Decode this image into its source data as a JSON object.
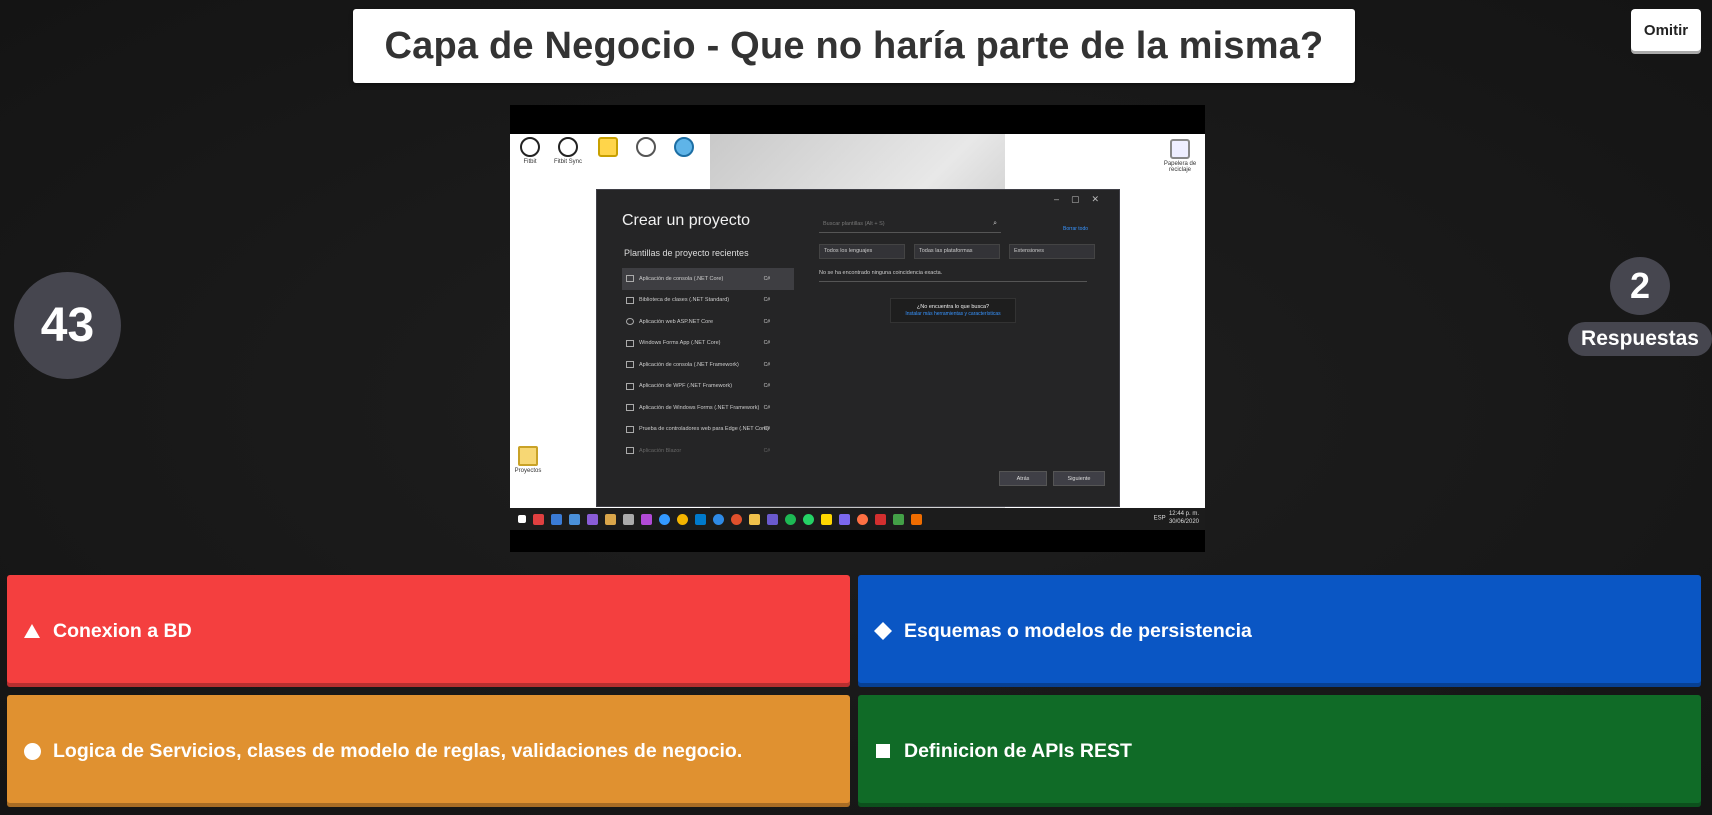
{
  "question": {
    "text": "Capa de Negocio - Que no haría parte de la misma?"
  },
  "skip_label": "Omitir",
  "timer": "43",
  "answers_count": {
    "value": "2",
    "label": "Respuestas"
  },
  "media": {
    "dialog": {
      "title": "Crear un proyecto",
      "subtitle": "Plantillas de proyecto recientes",
      "search_placeholder": "Buscar plantillas (Alt + S)",
      "clear_link": "Borrar todo",
      "filters": [
        "Todos los lenguajes",
        "Todas las plataformas",
        "Extensiones"
      ],
      "no_results": "No se ha encontrado ninguna coincidencia exacta.",
      "help_title": "¿No encuentra lo que busca?",
      "help_link": "Instalar más herramientas y características",
      "templates": [
        {
          "name": "Aplicación de consola (.NET Core)",
          "lang": "C#"
        },
        {
          "name": "Biblioteca de clases (.NET Standard)",
          "lang": "C#"
        },
        {
          "name": "Aplicación web ASP.NET Core",
          "lang": "C#"
        },
        {
          "name": "Windows Forms App (.NET Core)",
          "lang": "C#"
        },
        {
          "name": "Aplicación de consola (.NET Framework)",
          "lang": "C#"
        },
        {
          "name": "Aplicación de WPF (.NET Framework)",
          "lang": "C#"
        },
        {
          "name": "Aplicación de Windows Forms (.NET Framework)",
          "lang": "C#"
        },
        {
          "name": "Prueba de controladores web para Edge (.NET Core)",
          "lang": "C#"
        },
        {
          "name": "Aplicación Blazor",
          "lang": "C#"
        }
      ],
      "back_label": "Atrás",
      "next_label": "Siguiente"
    },
    "taskbar": {
      "time": "12:44 p. m.",
      "date": "30/06/2020",
      "lang": "ESP"
    },
    "desktop_icons": [
      "Fitbit",
      "Fitbit Sync",
      "Papelera de reciclaje",
      "Proyectos"
    ]
  },
  "answers": [
    {
      "shape": "triangle",
      "text": "Conexion a BD",
      "color": "#f43f3f"
    },
    {
      "shape": "diamond",
      "text": "Esquemas o modelos de persistencia",
      "color": "#0a56c4"
    },
    {
      "shape": "circle",
      "text": "Logica de Servicios, clases de modelo de reglas, validaciones de negocio.",
      "color": "#e09130"
    },
    {
      "shape": "square",
      "text": "Definicion de APIs REST",
      "color": "#106b27"
    }
  ]
}
